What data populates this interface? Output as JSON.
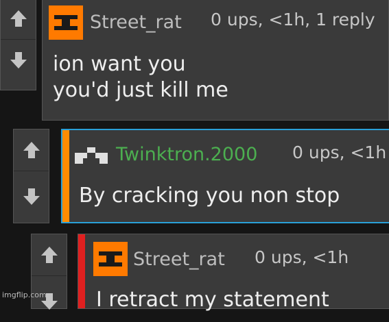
{
  "comments": [
    {
      "username": "Street_rat",
      "meta": "0 ups, <1h, 1 reply",
      "lines": [
        "ion want you",
        "you'd just kill me"
      ],
      "username_color": "#bdbdbd",
      "accent_color": null
    },
    {
      "username": "Twinktron.2000",
      "meta": "0 ups, <1h",
      "lines": [
        "By cracking you non stop"
      ],
      "username_color": "#4caf50",
      "accent_color": "#ff8c00",
      "border_color": "#2aa0d8"
    },
    {
      "username": "Street_rat",
      "meta": "0 ups, <1h",
      "lines": [
        "I retract my statement"
      ],
      "username_color": "#bdbdbd",
      "accent_color": "#e02020"
    }
  ],
  "icons": {
    "upvote": "arrow-up-icon",
    "downvote": "arrow-down-icon",
    "avatar_orange": "orange-block-avatar",
    "avatar_pixel": "pixel-avatar"
  },
  "watermark": "imgflip.com"
}
